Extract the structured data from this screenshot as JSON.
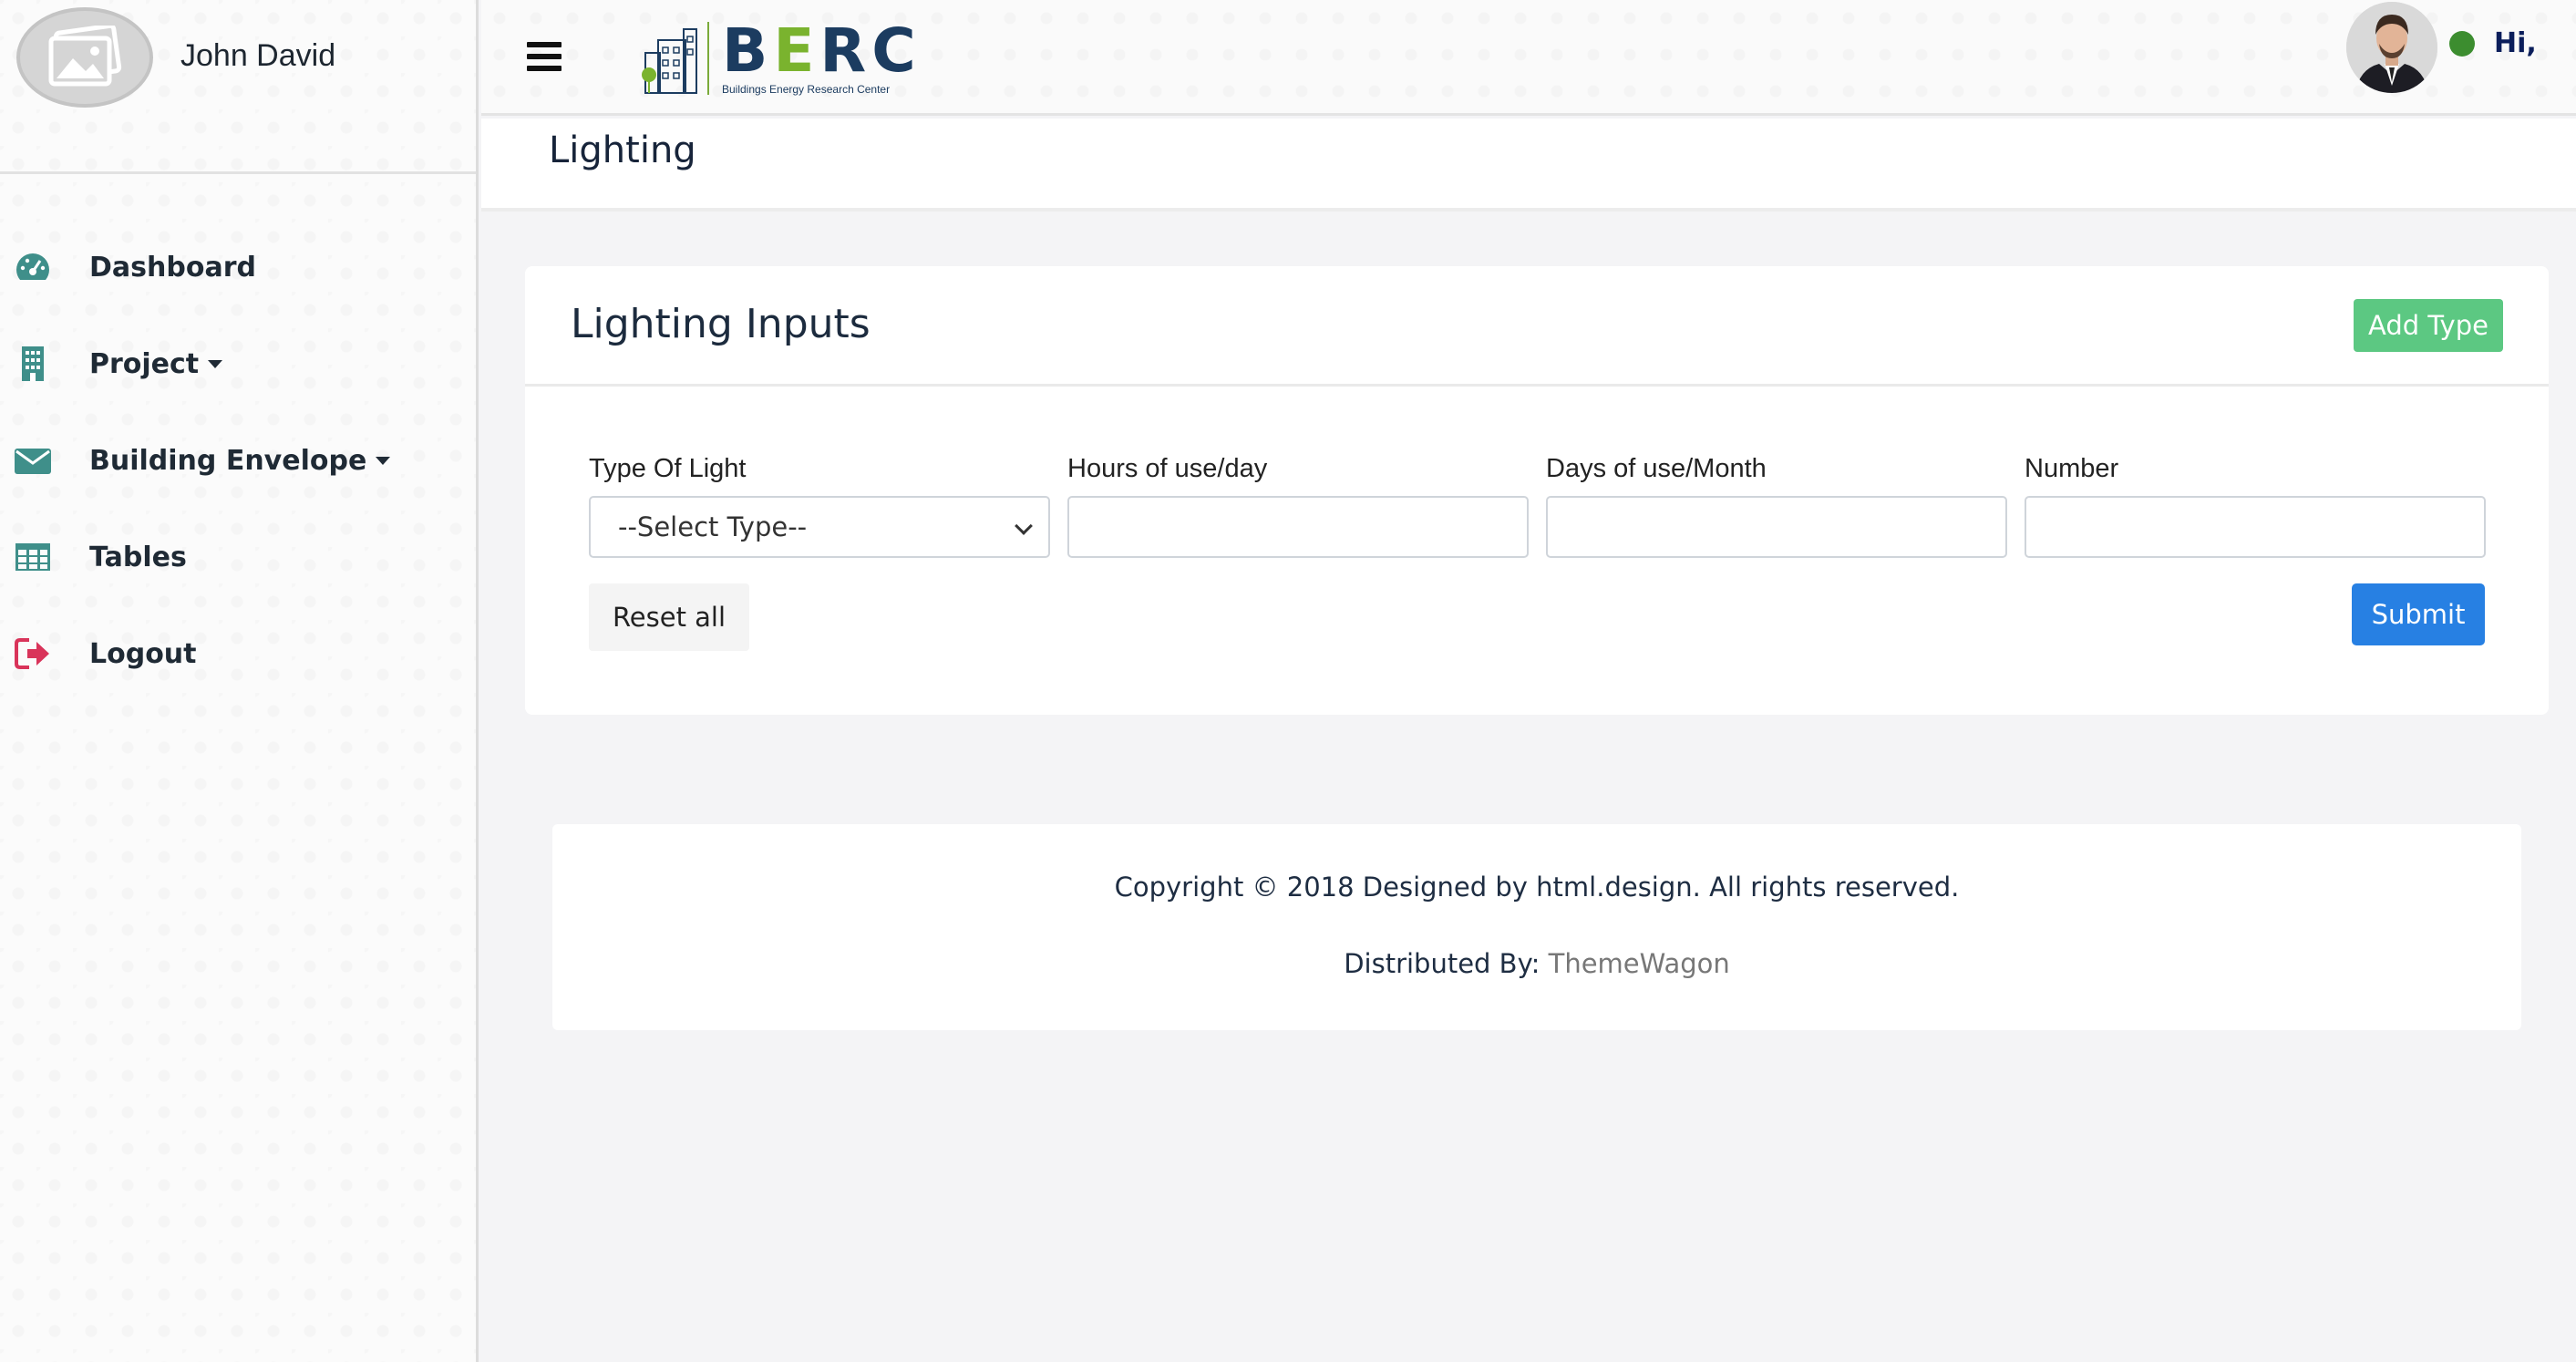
{
  "sidebar": {
    "profile_name": "John David",
    "items": [
      {
        "label": "Dashboard",
        "icon": "dashboard-gauge-icon",
        "has_caret": false
      },
      {
        "label": "Project",
        "icon": "building-icon",
        "has_caret": true
      },
      {
        "label": "Building Envelope",
        "icon": "envelope-icon",
        "has_caret": true
      },
      {
        "label": "Tables",
        "icon": "table-icon",
        "has_caret": false
      },
      {
        "label": "Logout",
        "icon": "logout-icon",
        "has_caret": false
      }
    ]
  },
  "topbar": {
    "logo_title": "BERC",
    "logo_subtitle": "Buildings Energy Research Center",
    "greeting": "Hi,"
  },
  "page": {
    "title": "Lighting"
  },
  "card": {
    "title": "Lighting Inputs",
    "add_type_label": "Add Type",
    "fields": [
      {
        "label": "Type Of Light",
        "type": "select",
        "value": "--Select Type--"
      },
      {
        "label": "Hours of use/day",
        "type": "text",
        "value": ""
      },
      {
        "label": "Days of use/Month",
        "type": "text",
        "value": ""
      },
      {
        "label": "Number",
        "type": "text",
        "value": ""
      }
    ],
    "reset_label": "Reset all",
    "submit_label": "Submit"
  },
  "footer": {
    "copyright": "Copyright © 2018 Designed by html.design. All rights reserved.",
    "distributed_prefix": "Distributed By: ",
    "distributed_link": "ThemeWagon"
  },
  "colors": {
    "add_type_bg": "#5cc882",
    "submit_bg": "#2780e3",
    "status_online": "#3c8d2f",
    "nav_icon_teal": "#3f8f8a",
    "logout_icon": "#d9345a",
    "brand_navy": "#1c3c60",
    "brand_green": "#7ab32e"
  }
}
